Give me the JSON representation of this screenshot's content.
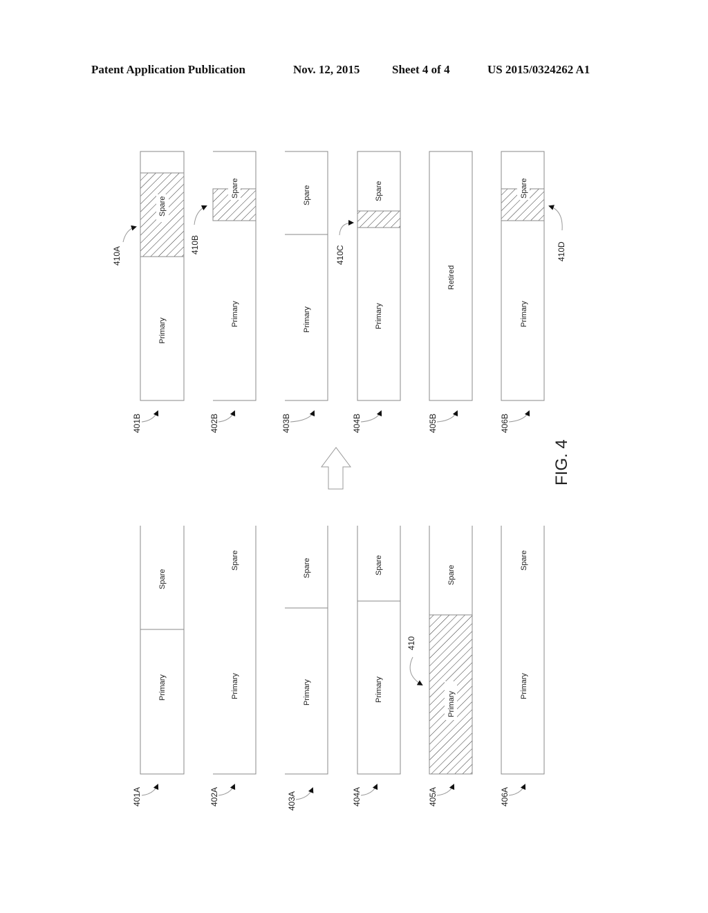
{
  "header": {
    "publication": "Patent Application Publication",
    "date": "Nov. 12, 2015",
    "sheet": "Sheet 4 of 4",
    "number": "US 2015/0324262 A1"
  },
  "figure": {
    "label": "FIG. 4",
    "before_columns": [
      {
        "ref": "401A",
        "primary_fraction": 0.58,
        "primary_label": "Primary",
        "spare_label": "Spare",
        "hatched": null
      },
      {
        "ref": "402A",
        "primary_fraction": 1.0,
        "primary_label": "Primary",
        "spare_label": "Spare",
        "hatched": null
      },
      {
        "ref": "403A",
        "primary_fraction": 0.67,
        "primary_label": "Primary",
        "spare_label": "Spare",
        "hatched": null
      },
      {
        "ref": "404A",
        "primary_fraction": 0.7,
        "primary_label": "Primary",
        "spare_label": "Spare",
        "hatched": null
      },
      {
        "ref": "405A",
        "primary_fraction": 0.64,
        "primary_label": "Primary",
        "spare_label": "Spare",
        "hatched": "primary",
        "callout": "410"
      },
      {
        "ref": "406A",
        "primary_fraction": 1.0,
        "primary_label": "Primary",
        "spare_label": "Spare",
        "hatched": null
      }
    ],
    "after_columns": [
      {
        "ref": "401B",
        "primary_label": "Primary",
        "spare_label": "Spare",
        "callout": "410A"
      },
      {
        "ref": "402B",
        "primary_label": "Primary",
        "spare_label": "Spare",
        "callout": "410B"
      },
      {
        "ref": "403B",
        "primary_label": "Primary",
        "spare_label": "Spare",
        "callout": null
      },
      {
        "ref": "404B",
        "primary_label": "Primary",
        "spare_label": "Spare",
        "callout": "410C"
      },
      {
        "ref": "405B",
        "retired_label": "Retired",
        "callout": null
      },
      {
        "ref": "406B",
        "primary_label": "Primary",
        "spare_label": "Spare",
        "callout": "410D"
      }
    ],
    "transition_arrow": "up-arrow"
  }
}
